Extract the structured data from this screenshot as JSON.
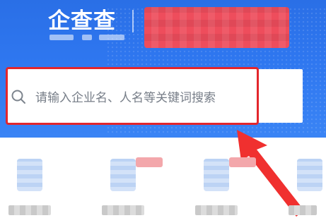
{
  "header": {
    "logo_text": "企查查",
    "redacted_banner": "redacted",
    "colors": {
      "hero": "#2e76ef",
      "banner": "#ee4d5c"
    }
  },
  "search": {
    "icon": "search-icon",
    "placeholder": "请输入企业名、人名等关键词搜索"
  },
  "annotation": {
    "highlight_color": "#e3262c",
    "arrow_color": "#f0302f"
  },
  "shortcuts": [
    {
      "icon": "blurred-icon",
      "has_tag": false
    },
    {
      "icon": "blurred-icon",
      "has_tag": true
    },
    {
      "icon": "blurred-icon",
      "has_tag": true
    },
    {
      "icon": "blurred-icon",
      "has_tag": false
    }
  ]
}
